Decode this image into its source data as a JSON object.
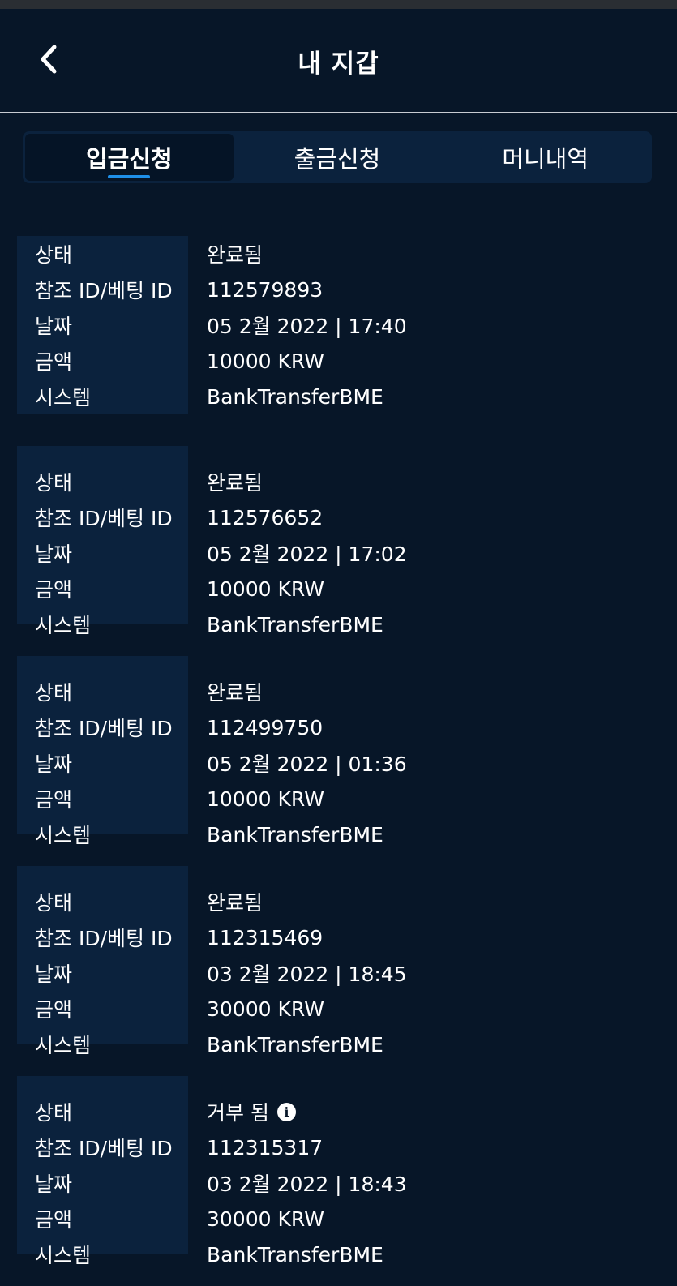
{
  "header": {
    "title": "내 지갑"
  },
  "tabs": [
    {
      "label": "입금신청",
      "active": true
    },
    {
      "label": "출금신청",
      "active": false
    },
    {
      "label": "머니내역",
      "active": false
    }
  ],
  "labels": {
    "status": "상태",
    "ref_id": "참조 ID/베팅 ID",
    "date": "날짜",
    "amount": "금액",
    "system": "시스템"
  },
  "records": [
    {
      "status": "완료됨",
      "ref_id": "112579893",
      "date": "05 2월 2022 | 17:40",
      "amount": "10000 KRW",
      "system": "BankTransferBME",
      "info": false
    },
    {
      "status": "완료됨",
      "ref_id": "112576652",
      "date": "05 2월 2022 | 17:02",
      "amount": "10000 KRW",
      "system": "BankTransferBME",
      "info": false
    },
    {
      "status": "완료됨",
      "ref_id": "112499750",
      "date": "05 2월 2022 | 01:36",
      "amount": "10000 KRW",
      "system": "BankTransferBME",
      "info": false
    },
    {
      "status": "완료됨",
      "ref_id": "112315469",
      "date": "03 2월 2022 | 18:45",
      "amount": "30000 KRW",
      "system": "BankTransferBME",
      "info": false
    },
    {
      "status": "거부 됨",
      "ref_id": "112315317",
      "date": "03 2월 2022 | 18:43",
      "amount": "30000 KRW",
      "system": "BankTransferBME",
      "info": true
    }
  ],
  "icons": {
    "back": "chevron-left-icon",
    "info": "info-icon"
  },
  "colors": {
    "background": "#071628",
    "panel": "#0b223d",
    "accent": "#1e8fe8"
  }
}
